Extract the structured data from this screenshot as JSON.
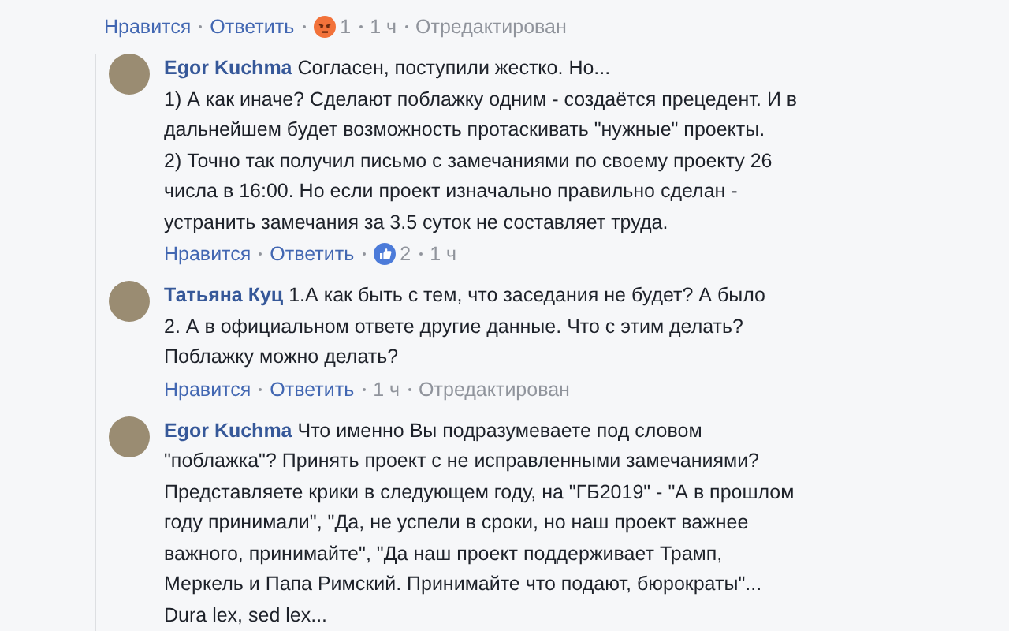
{
  "top_comment": {
    "actions": [
      "Нравится",
      "Ответить"
    ],
    "reaction": {
      "kind": "angry",
      "count": "1"
    },
    "time": "1 ч",
    "edited": "Отредактирован"
  },
  "replies": [
    {
      "author": "Egor Kuchma",
      "lines": [
        "Согласен, поступили жестко. Но...",
        "1) А как иначе? Сделают поблажку одним - создаётся прецедент. И в",
        "дальнейшем будет возможность протаскивать \"нужные\" проекты.",
        "2) Точно так получил письмо с замечаниями по своему проекту 26",
        "числа в 16:00. Но если проект изначально правильно сделан -",
        "устранить замечания за 3.5 суток не составляет труда."
      ],
      "actions": [
        "Нравится",
        "Ответить"
      ],
      "reaction": {
        "kind": "like",
        "count": "2"
      },
      "time": "1 ч"
    },
    {
      "author": "Татьяна Куц",
      "lines": [
        "1.А как быть с тем, что заседания не будет? А было",
        "2. А в официальном ответе другие данные. Что с этим делать?",
        "Поблажку можно делать?"
      ],
      "actions": [
        "Нравится",
        "Ответить"
      ],
      "time": "1 ч",
      "edited": "Отредактирован"
    },
    {
      "author": "Egor Kuchma",
      "lines": [
        "Что именно Вы подразумеваете под словом",
        "\"поблажка\"? Принять проект с не исправленными замечаниями?",
        "Представляете крики в следующем году, на \"ГБ2019\" - \"А в прошлом",
        "году принимали\", \"Да, не успели в сроки, но наш проект важнее",
        "важного, принимайте\", \"Да наш проект поддерживает Трамп,",
        "Меркель и Папа Римский. Принимайте что подают, бюрократы\"...",
        "Dura lex, sed lex..."
      ]
    }
  ]
}
